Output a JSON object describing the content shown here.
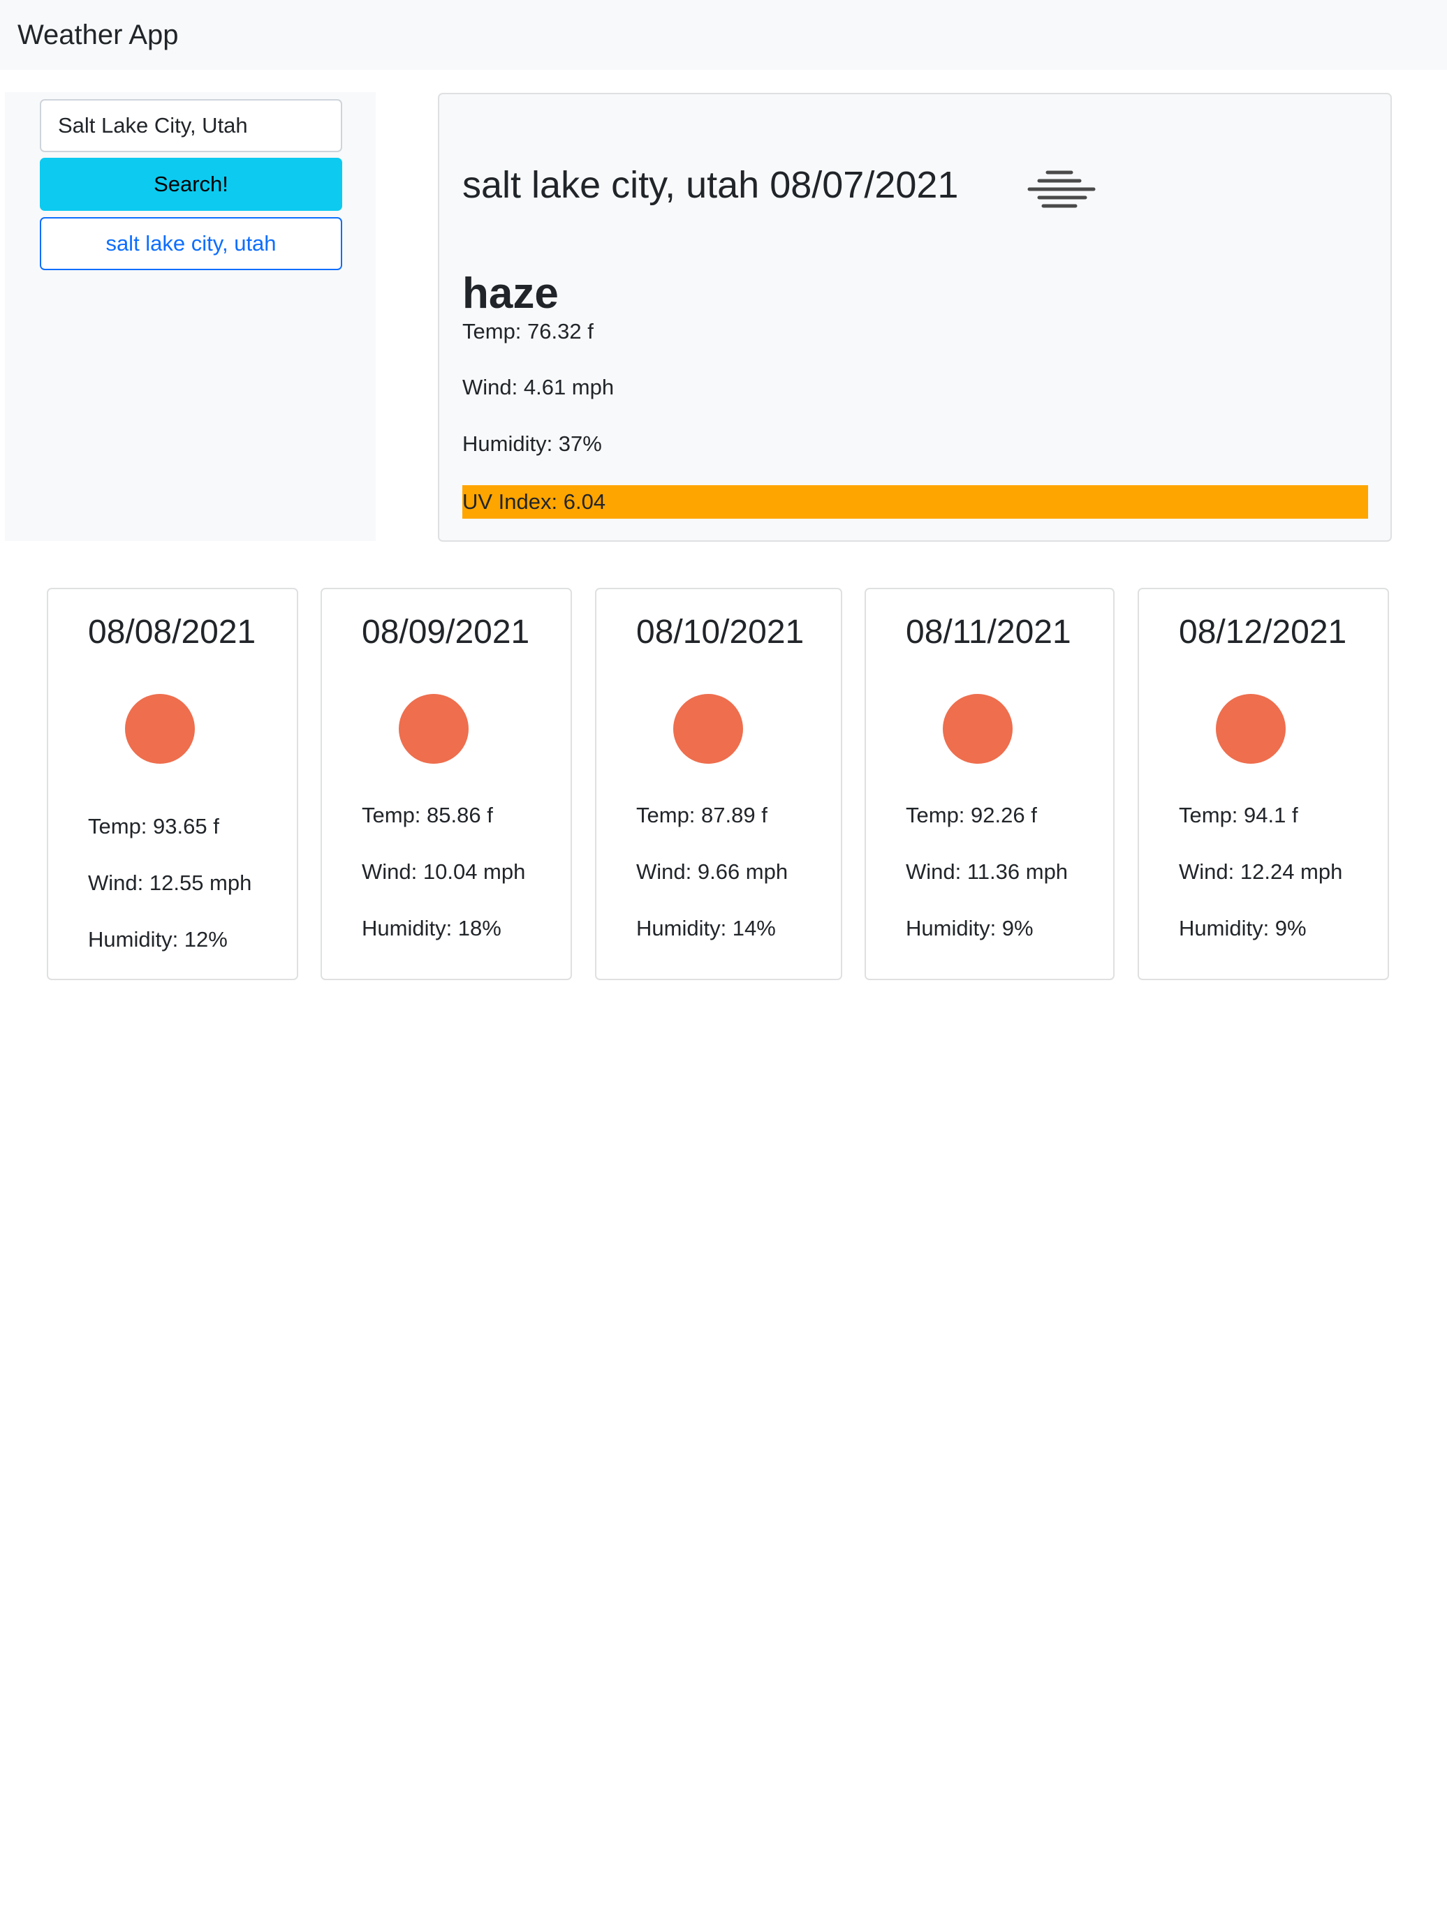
{
  "app": {
    "title": "Weather App"
  },
  "search": {
    "value": "Salt Lake City, Utah",
    "button_label": "Search!",
    "history": [
      "salt lake city, utah"
    ]
  },
  "current": {
    "title": "salt lake city, utah 08/07/2021",
    "icon": "haze-icon",
    "condition": "haze",
    "temp": "Temp: 76.32 f",
    "wind": "Wind: 4.61 mph",
    "humidity": "Humidity: 37%",
    "uv": "UV Index: 6.04",
    "uv_color": "#ffa500"
  },
  "forecast": [
    {
      "date": "08/08/2021",
      "icon": "sun-icon",
      "temp": "Temp: 93.65 f",
      "wind": "Wind: 12.55 mph",
      "humidity": "Humidity: 12%"
    },
    {
      "date": "08/09/2021",
      "icon": "sun-icon",
      "temp": "Temp: 85.86 f",
      "wind": "Wind: 10.04 mph",
      "humidity": "Humidity: 18%"
    },
    {
      "date": "08/10/2021",
      "icon": "sun-icon",
      "temp": "Temp: 87.89 f",
      "wind": "Wind: 9.66 mph",
      "humidity": "Humidity: 14%"
    },
    {
      "date": "08/11/2021",
      "icon": "sun-icon",
      "temp": "Temp: 92.26 f",
      "wind": "Wind: 11.36 mph",
      "humidity": "Humidity: 9%"
    },
    {
      "date": "08/12/2021",
      "icon": "sun-icon",
      "temp": "Temp: 94.1 f",
      "wind": "Wind: 12.24 mph",
      "humidity": "Humidity: 9%"
    }
  ],
  "colors": {
    "navbar_bg": "#f8f9fa",
    "search_button": "#0dcaf0",
    "history_button_border": "#0d6efd",
    "sun": "#ee6e4e"
  }
}
